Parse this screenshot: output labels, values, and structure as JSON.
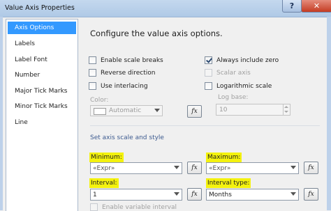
{
  "window": {
    "title": "Value Axis Properties",
    "help_label": "?",
    "close_label": "✕"
  },
  "sidebar": {
    "items": [
      {
        "label": "Axis Options"
      },
      {
        "label": "Labels"
      },
      {
        "label": "Label Font"
      },
      {
        "label": "Number"
      },
      {
        "label": "Major Tick Marks"
      },
      {
        "label": "Minor Tick Marks"
      },
      {
        "label": "Line"
      }
    ],
    "selected": "Axis Options"
  },
  "main": {
    "heading": "Configure the value axis options.",
    "options": {
      "enable_scale_breaks": {
        "label": "Enable scale breaks",
        "checked": false
      },
      "reverse_direction": {
        "label": "Reverse direction",
        "checked": false
      },
      "use_interlacing": {
        "label": "Use interlacing",
        "checked": false
      },
      "always_include_zero": {
        "label": "Always include zero",
        "checked": true
      },
      "scalar_axis": {
        "label": "Scalar axis",
        "checked": false,
        "disabled": true
      },
      "logarithmic_scale": {
        "label": "Logarithmic scale",
        "checked": false
      }
    },
    "color": {
      "label": "Color:",
      "value": "Automatic"
    },
    "log_base": {
      "label": "Log base:",
      "value": "10"
    },
    "fx_label": "fx",
    "scale_section": {
      "title": "Set axis scale and style",
      "minimum": {
        "label": "Minimum:",
        "value": "«Expr»"
      },
      "maximum": {
        "label": "Maximum:",
        "value": "«Expr»"
      },
      "interval": {
        "label": "Interval:",
        "value": "1"
      },
      "interval_type": {
        "label": "Interval type:",
        "value": "Months"
      },
      "enable_variable_interval": {
        "label": "Enable variable interval",
        "checked": false,
        "disabled": true
      }
    }
  },
  "colors": {
    "highlight": "#f4f20e",
    "selection": "#3399ff",
    "section_title": "#3c5a8f"
  }
}
